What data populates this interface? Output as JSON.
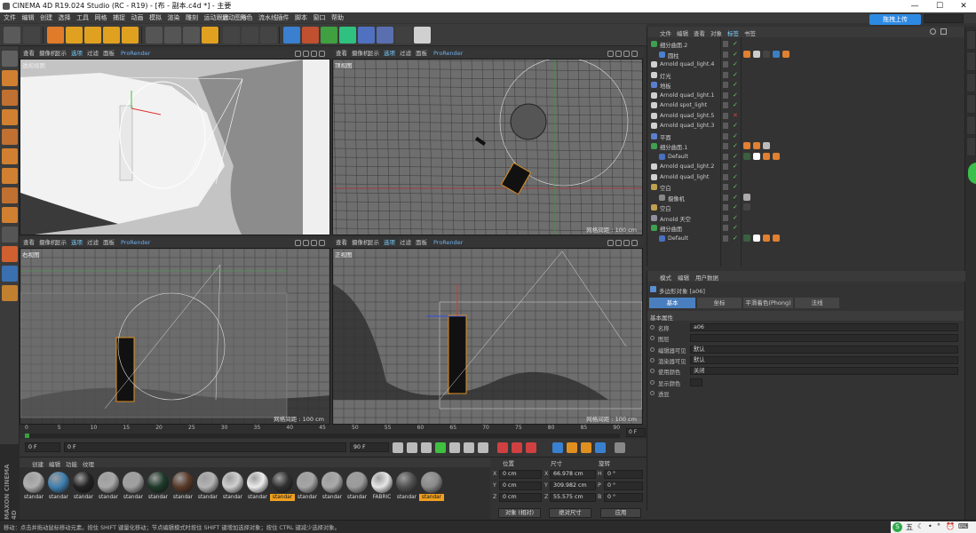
{
  "titlebar": {
    "title": "CINEMA 4D R19.024 Studio (RC - R19) - [布 - 副本.c4d *] - 主要",
    "min": "—",
    "max": "☐",
    "close": "✕"
  },
  "menu": [
    "文件",
    "编辑",
    "创建",
    "选择",
    "工具",
    "网格",
    "捕捉",
    "动画",
    "模拟",
    "渲染",
    "雕刻",
    "运动跟踪",
    "运动图形",
    "角色",
    "流水线",
    "插件",
    "脚本",
    "窗口",
    "帮助"
  ],
  "upload_label": "拖拽上传",
  "viewports": [
    {
      "label": "透视视图",
      "menu": [
        "查看",
        "摄像机",
        "显示",
        "选项",
        "过滤",
        "面板"
      ],
      "render": "ProRender",
      "grid": ""
    },
    {
      "label": "顶视图",
      "menu": [
        "查看",
        "摄像机",
        "显示",
        "选项",
        "过滤",
        "面板"
      ],
      "render": "ProRender",
      "grid": "网格间距 : 100 cm"
    },
    {
      "label": "右视图",
      "menu": [
        "查看",
        "摄像机",
        "显示",
        "选项",
        "过滤",
        "面板"
      ],
      "render": "ProRender",
      "grid": "网格间距 : 100 cm"
    },
    {
      "label": "正视图",
      "menu": [
        "查看",
        "摄像机",
        "显示",
        "选项",
        "过滤",
        "面板"
      ],
      "render": "ProRender",
      "grid": "网格间距 : 100 cm"
    }
  ],
  "objmgr": {
    "menu": [
      "文件",
      "编辑",
      "查看",
      "对象",
      "标签",
      "书签"
    ],
    "active_menu": "标签",
    "objects": [
      {
        "name": "细分曲面.2",
        "depth": 0,
        "icon": "subdiv",
        "check": "✓"
      },
      {
        "name": "圆柱",
        "depth": 1,
        "icon": "cylinder",
        "check": "✓"
      },
      {
        "name": "Arnold quad_light.4",
        "depth": 0,
        "icon": "light",
        "check": "✓"
      },
      {
        "name": "灯光",
        "depth": 0,
        "icon": "light",
        "check": "✓"
      },
      {
        "name": "地板",
        "depth": 0,
        "icon": "floor",
        "check": "✓"
      },
      {
        "name": "Arnold quad_light.1",
        "depth": 0,
        "icon": "light",
        "check": "✓"
      },
      {
        "name": "Arnold spot_light",
        "depth": 0,
        "icon": "light",
        "check": "✓"
      },
      {
        "name": "Arnold quad_light.5",
        "depth": 0,
        "icon": "light",
        "check": "✕"
      },
      {
        "name": "Arnold quad_light.3",
        "depth": 0,
        "icon": "light",
        "check": "✓"
      },
      {
        "name": "平面",
        "depth": 0,
        "icon": "plane",
        "check": "✓"
      },
      {
        "name": "细分曲面.1",
        "depth": 0,
        "icon": "subdiv",
        "check": "✓"
      },
      {
        "name": "Default",
        "depth": 1,
        "icon": "cloth",
        "check": "✓"
      },
      {
        "name": "Arnold quad_light.2",
        "depth": 0,
        "icon": "light",
        "check": "✓"
      },
      {
        "name": "Arnold quad_light",
        "depth": 0,
        "icon": "light",
        "check": "✓"
      },
      {
        "name": "空白",
        "depth": 0,
        "icon": "null",
        "check": "✓"
      },
      {
        "name": "摄像机",
        "depth": 1,
        "icon": "camera",
        "check": "✓"
      },
      {
        "name": "空白",
        "depth": 0,
        "icon": "null",
        "check": "✓"
      },
      {
        "name": "Arnold 天空",
        "depth": 0,
        "icon": "sky",
        "check": "✓"
      },
      {
        "name": "细分曲面",
        "depth": 0,
        "icon": "subdiv",
        "check": "✓"
      },
      {
        "name": "Default",
        "depth": 1,
        "icon": "cloth",
        "check": "✓"
      }
    ]
  },
  "attrmgr": {
    "menu": [
      "模式",
      "编辑",
      "用户数据"
    ],
    "object_label": "多边形对象 [a06]",
    "tabs": [
      "基本",
      "坐标",
      "平滑着色(Phong)",
      "法线"
    ],
    "section": "基本属性",
    "rows": [
      {
        "label": "名称",
        "value": "a06"
      },
      {
        "label": "图层",
        "value": ""
      },
      {
        "label": "编辑器可见",
        "value": "默认"
      },
      {
        "label": "渲染器可见",
        "value": "默认"
      },
      {
        "label": "使用颜色",
        "value": "关闭"
      },
      {
        "label": "显示颜色",
        "value": ""
      },
      {
        "label": "透显",
        "value": ""
      }
    ]
  },
  "timeline": {
    "ticks": [
      "0",
      "5",
      "10",
      "15",
      "20",
      "25",
      "30",
      "35",
      "40",
      "45",
      "50",
      "55",
      "60",
      "65",
      "70",
      "75",
      "80",
      "85",
      "90"
    ],
    "end_field": "0 F"
  },
  "transport": {
    "start": "0 F",
    "current": "0 F",
    "end": "90 F",
    "max": "90 F"
  },
  "materials": {
    "menu": [
      "创建",
      "编辑",
      "功能",
      "纹理"
    ],
    "items": [
      {
        "label": "standar",
        "color": "#b0b0b0"
      },
      {
        "label": "standar",
        "color": "#3f7fb0"
      },
      {
        "label": "standar",
        "color": "#222222"
      },
      {
        "label": "standar",
        "color": "#a8a8a8"
      },
      {
        "label": "standar",
        "color": "#a0a0a0"
      },
      {
        "label": "standar",
        "color": "#1e3a2a"
      },
      {
        "label": "standar",
        "color": "#5a3a28"
      },
      {
        "label": "standar",
        "color": "#b4b4b4"
      },
      {
        "label": "standar",
        "color": "#d0d0d0"
      },
      {
        "label": "standar",
        "color": "#ececec"
      },
      {
        "label": "standar",
        "color": "#303030",
        "selected": true
      },
      {
        "label": "standar",
        "color": "#a6a6a6"
      },
      {
        "label": "standar",
        "color": "#aaaaaa"
      },
      {
        "label": "standar",
        "color": "#9c9c9c"
      },
      {
        "label": "FABRIC",
        "color": "#e6e6e6"
      },
      {
        "label": "standar",
        "color": "#505050"
      },
      {
        "label": "standar",
        "color": "#8a8a8a",
        "selected": true
      }
    ]
  },
  "coords": {
    "headers": [
      "位置",
      "尺寸",
      "旋转"
    ],
    "rows": [
      {
        "axis": "X",
        "pos": "0 cm",
        "size_axis": "X",
        "size": "66.978 cm",
        "rot_axis": "H",
        "rot": "0 °"
      },
      {
        "axis": "Y",
        "pos": "0 cm",
        "size_axis": "Y",
        "size": "309.982 cm",
        "rot_axis": "P",
        "rot": "0 °"
      },
      {
        "axis": "Z",
        "pos": "0 cm",
        "size_axis": "Z",
        "size": "55.575 cm",
        "rot_axis": "B",
        "rot": "0 °"
      }
    ],
    "mode1": "对象 (相对)",
    "mode2": "绝对尺寸",
    "apply": "应用"
  },
  "status": "移动：点击并拖动鼠标移动元素。按住 SHIFT 键量化移动；节点编辑模式时按住 SHIFT 键增加选择对象；按住 CTRL 键减少选择对象。",
  "tray": {
    "ime": "S",
    "lang": "五",
    "moon": "☾",
    "dot": "•",
    "deg": "°",
    "clock": "⏰",
    "keyboard": "⌨"
  },
  "side_logo": "MAXON CINEMA 4D"
}
